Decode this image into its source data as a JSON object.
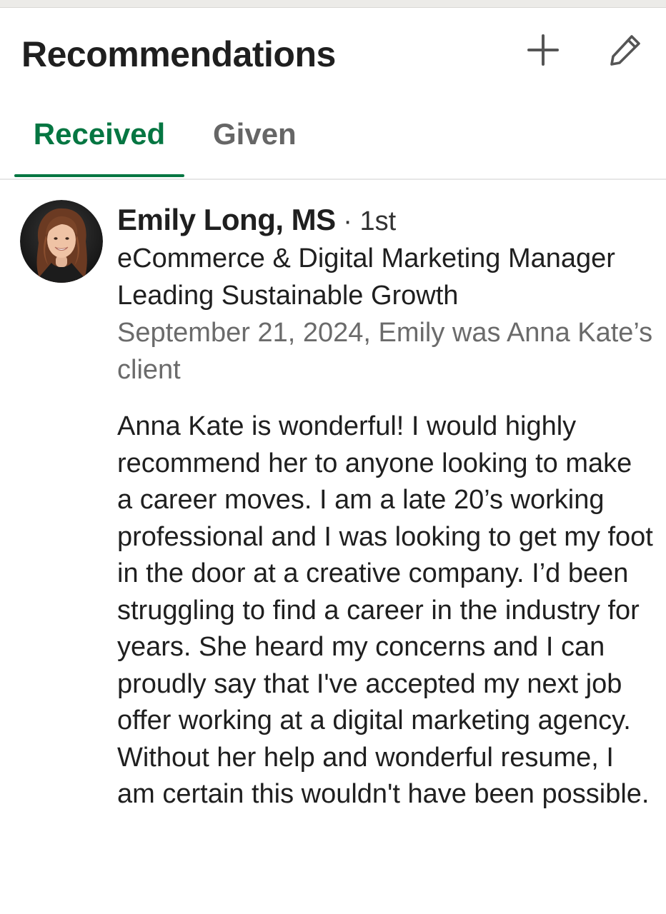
{
  "header": {
    "title": "Recommendations",
    "add_icon": "plus-icon",
    "edit_icon": "pencil-icon"
  },
  "tabs": [
    {
      "label": "Received",
      "active": true
    },
    {
      "label": "Given",
      "active": false
    }
  ],
  "colors": {
    "accent": "#057642",
    "inactive_tab": "#666666",
    "meta_text": "#6b6b6b"
  },
  "recommendation": {
    "name": "Emily Long, MS",
    "separator": " · ",
    "degree": "1st",
    "headline": "eCommerce & Digital Marketing Manager Leading Sustainable Growth",
    "meta": "September 21, 2024, Emily was Anna Kate’s client",
    "text": "Anna Kate is wonderful! I would highly recommend her to anyone looking to make a career moves. I am a late 20’s working professional and I was looking to get my foot in the door at a creative company. I’d been struggling to find a career in the industry for years. She heard my concerns and I can proudly say that I've accepted my next job offer working at a digital marketing agency. Without her help and wonderful resume, I am certain this wouldn't have been possible."
  }
}
